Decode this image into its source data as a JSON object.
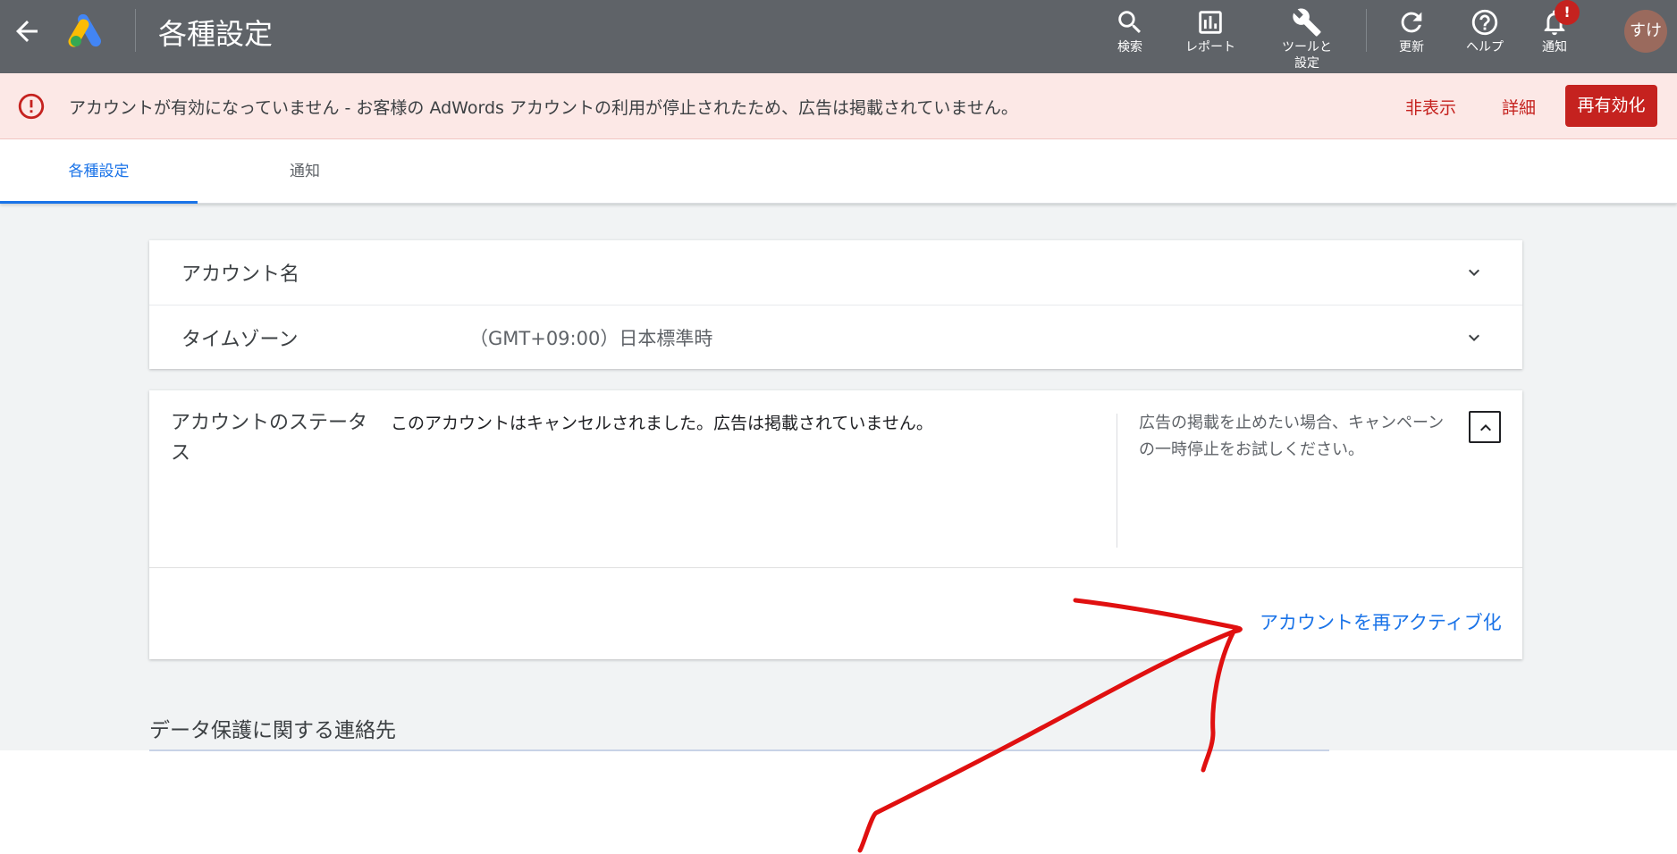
{
  "colors": {
    "topbar": "#5f6368",
    "alert_bg": "#fce8e6",
    "alert_red": "#c5221f",
    "accent_blue": "#1a73e8",
    "annotation_red": "#e01010"
  },
  "topbar": {
    "title": "各種設定",
    "buttons": [
      {
        "label": "検索",
        "icon": "search-icon"
      },
      {
        "label": "レポート",
        "icon": "bar-chart-icon"
      },
      {
        "label": "ツールと\n設定",
        "icon": "wrench-icon"
      },
      {
        "label": "更新",
        "icon": "refresh-icon"
      },
      {
        "label": "ヘルプ",
        "icon": "help-icon"
      },
      {
        "label": "通知",
        "icon": "bell-icon"
      }
    ],
    "notification_badge": "!",
    "avatar_text": "すけ"
  },
  "alert": {
    "message": "アカウントが有効になっていません - お客様の AdWords アカウントの利用が停止されたため、広告は掲載されていません。",
    "hide_label": "非表示",
    "detail_label": "詳細",
    "reactivate_label": "再有効化"
  },
  "tabs": [
    {
      "label": "各種設定",
      "active": true
    },
    {
      "label": "通知",
      "active": false
    }
  ],
  "settings": {
    "account_name_label": "アカウント名",
    "timezone_label": "タイムゾーン",
    "timezone_value": "（GMT+09:00）日本標準時"
  },
  "status": {
    "label": "アカウントのステータス",
    "text": "このアカウントはキャンセルされました。広告は掲載されていません。",
    "hint": "広告の掲載を止めたい場合、キャンペーンの一時停止をお試しください。",
    "reactivate_link": "アカウントを再アクティブ化"
  },
  "section": {
    "heading": "データ保護に関する連絡先"
  }
}
